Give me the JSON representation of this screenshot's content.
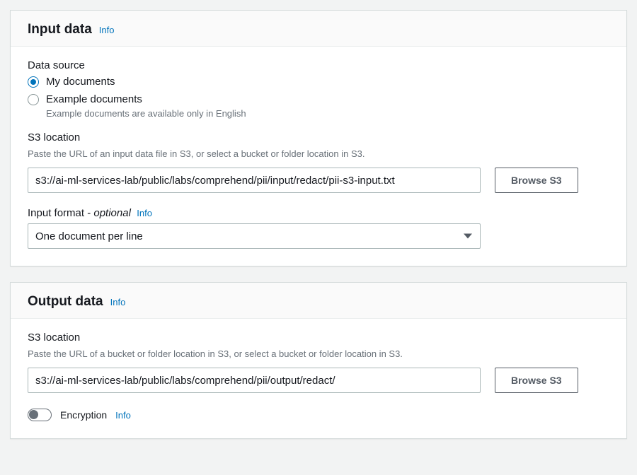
{
  "common": {
    "info": "Info"
  },
  "input": {
    "title": "Input data",
    "dataSource": {
      "label": "Data source",
      "optionMy": "My documents",
      "optionExample": "Example documents",
      "exampleHint": "Example documents are available only in English"
    },
    "s3": {
      "label": "S3 location",
      "desc": "Paste the URL of an input data file in S3, or select a bucket or folder location in S3.",
      "value": "s3://ai-ml-services-lab/public/labs/comprehend/pii/input/redact/pii-s3-input.txt",
      "browse": "Browse S3"
    },
    "format": {
      "label": "Input format - ",
      "optional": "optional",
      "value": "One document per line"
    }
  },
  "output": {
    "title": "Output data",
    "s3": {
      "label": "S3 location",
      "desc": "Paste the URL of a bucket or folder location in S3, or select a bucket or folder location in S3.",
      "value": "s3://ai-ml-services-lab/public/labs/comprehend/pii/output/redact/",
      "browse": "Browse S3"
    },
    "encryption": {
      "label": "Encryption"
    }
  }
}
